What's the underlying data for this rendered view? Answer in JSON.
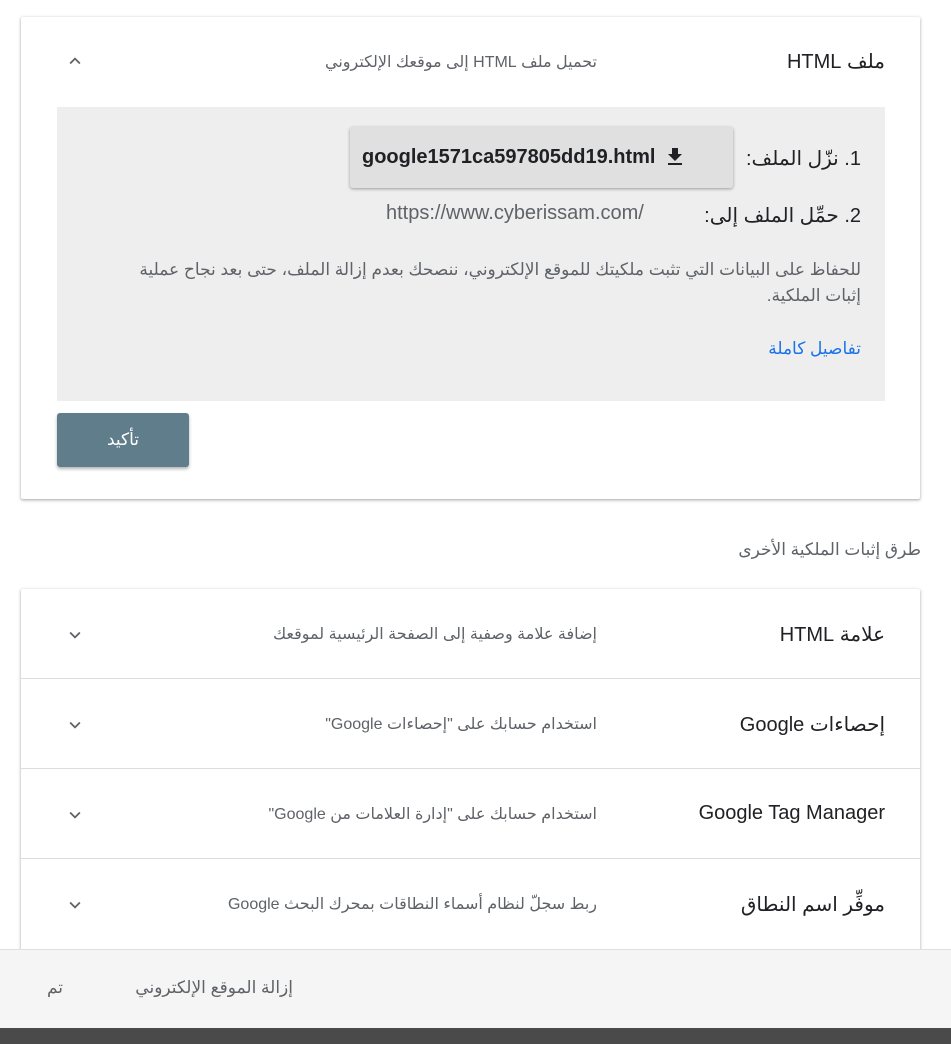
{
  "html_file": {
    "title": "ملف HTML",
    "description": "تحميل ملف HTML إلى موقعك الإلكتروني",
    "step1_label": "1. نزّل الملف:",
    "download_filename": "google1571ca597805dd19.html",
    "step2_label": "2. حمِّل الملف إلى:",
    "site_url": "https://www.cyberissam.com/",
    "note": "للحفاظ على البيانات التي تثبت ملكيتك للموقع الإلكتروني، ننصحك بعدم إزالة الملف، حتى بعد نجاح عملية إثبات الملكية.",
    "details_link": "تفاصيل كاملة",
    "confirm_button": "تأكيد"
  },
  "other_methods": {
    "heading": "طرق إثبات الملكية الأخرى",
    "items": [
      {
        "title": "علامة HTML",
        "description": "إضافة علامة وصفية إلى الصفحة الرئيسية لموقعك"
      },
      {
        "title": "إحصاءات Google",
        "description": "استخدام حسابك على \"إحصاءات Google\""
      },
      {
        "title": "Google Tag Manager",
        "description": "استخدام حسابك على \"إدارة العلامات من Google\""
      },
      {
        "title": "موفِّر اسم النطاق",
        "description": "ربط سجلّ لنظام أسماء النطاقات بمحرك البحث Google"
      }
    ]
  },
  "footer": {
    "remove_site": "إزالة الموقع الإلكتروني",
    "done": "تم"
  },
  "colors": {
    "accent_button": "#607d8b",
    "link": "#1a73e8",
    "panel_bg": "#eeeeee"
  },
  "icons": {
    "collapse": "chevron-up-icon",
    "expand": "chevron-down-icon",
    "download": "download-icon"
  }
}
